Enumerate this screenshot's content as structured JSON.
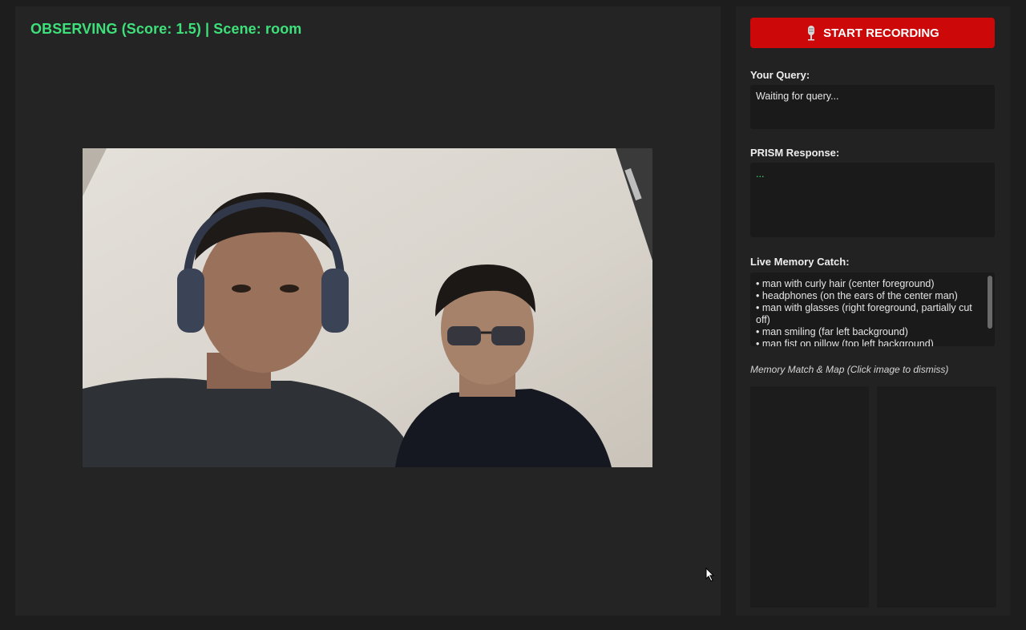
{
  "status": {
    "text": "OBSERVING (Score: 1.5) | Scene: room",
    "color": "#3ee07a"
  },
  "video": {
    "icon": "camera-feed"
  },
  "sidebar": {
    "record_button": {
      "label": "START RECORDING",
      "icon": "microphone-icon",
      "color": "#cc0808"
    },
    "query": {
      "label": "Your Query:",
      "text": "Waiting for query..."
    },
    "response": {
      "label": "PRISM Response:",
      "text": "..."
    },
    "memory": {
      "label": "Live Memory Catch:",
      "items": [
        "• man with curly hair (center foreground)",
        "• headphones (on the ears of the center man)",
        "• man with glasses (right foreground, partially cut off)",
        "• man smiling (far left background)",
        "• man fist on pillow (top left background)"
      ]
    },
    "memory_match": {
      "caption": "Memory Match & Map (Click image to dismiss)"
    }
  }
}
